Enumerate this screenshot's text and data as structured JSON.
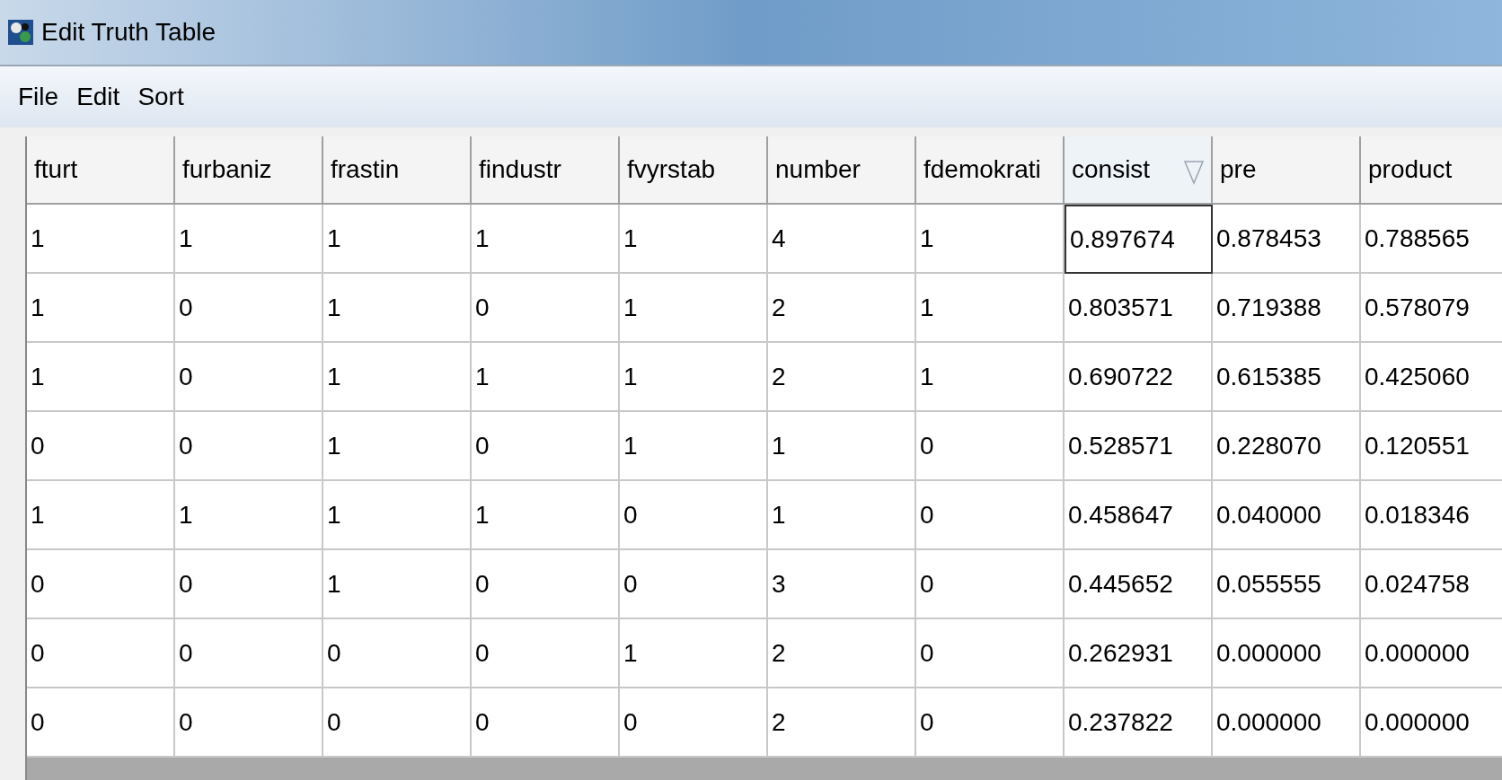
{
  "window": {
    "title": "Edit Truth Table"
  },
  "menu": [
    "File",
    "Edit",
    "Sort"
  ],
  "table": {
    "columns": [
      {
        "label": "fturt",
        "sorted": false
      },
      {
        "label": "furbaniz",
        "sorted": false
      },
      {
        "label": "frastin",
        "sorted": false
      },
      {
        "label": "findustr",
        "sorted": false
      },
      {
        "label": "fvyrstab",
        "sorted": false
      },
      {
        "label": "number",
        "sorted": false
      },
      {
        "label": "fdemokrati",
        "sorted": false
      },
      {
        "label": "consist",
        "sorted": true
      },
      {
        "label": "pre",
        "sorted": false
      },
      {
        "label": "product",
        "sorted": false
      }
    ],
    "rows": [
      {
        "cells": [
          {
            "text": "1",
            "focused": false
          },
          {
            "text": "1",
            "focused": false
          },
          {
            "text": "1",
            "focused": false
          },
          {
            "text": "1",
            "focused": false
          },
          {
            "text": "1",
            "focused": false
          },
          {
            "text": "4",
            "focused": false
          },
          {
            "text": "1",
            "focused": false
          },
          {
            "text": "0.897674",
            "focused": true
          },
          {
            "text": "0.878453",
            "focused": false
          },
          {
            "text": "0.788565",
            "focused": false
          }
        ]
      },
      {
        "cells": [
          {
            "text": "1",
            "focused": false
          },
          {
            "text": "0",
            "focused": false
          },
          {
            "text": "1",
            "focused": false
          },
          {
            "text": "0",
            "focused": false
          },
          {
            "text": "1",
            "focused": false
          },
          {
            "text": "2",
            "focused": false
          },
          {
            "text": "1",
            "focused": false
          },
          {
            "text": "0.803571",
            "focused": false
          },
          {
            "text": "0.719388",
            "focused": false
          },
          {
            "text": "0.578079",
            "focused": false
          }
        ]
      },
      {
        "cells": [
          {
            "text": "1",
            "focused": false
          },
          {
            "text": "0",
            "focused": false
          },
          {
            "text": "1",
            "focused": false
          },
          {
            "text": "1",
            "focused": false
          },
          {
            "text": "1",
            "focused": false
          },
          {
            "text": "2",
            "focused": false
          },
          {
            "text": "1",
            "focused": false
          },
          {
            "text": "0.690722",
            "focused": false
          },
          {
            "text": "0.615385",
            "focused": false
          },
          {
            "text": "0.425060",
            "focused": false
          }
        ]
      },
      {
        "cells": [
          {
            "text": "0",
            "focused": false
          },
          {
            "text": "0",
            "focused": false
          },
          {
            "text": "1",
            "focused": false
          },
          {
            "text": "0",
            "focused": false
          },
          {
            "text": "1",
            "focused": false
          },
          {
            "text": "1",
            "focused": false
          },
          {
            "text": "0",
            "focused": false
          },
          {
            "text": "0.528571",
            "focused": false
          },
          {
            "text": "0.228070",
            "focused": false
          },
          {
            "text": "0.120551",
            "focused": false
          }
        ]
      },
      {
        "cells": [
          {
            "text": "1",
            "focused": false
          },
          {
            "text": "1",
            "focused": false
          },
          {
            "text": "1",
            "focused": false
          },
          {
            "text": "1",
            "focused": false
          },
          {
            "text": "0",
            "focused": false
          },
          {
            "text": "1",
            "focused": false
          },
          {
            "text": "0",
            "focused": false
          },
          {
            "text": "0.458647",
            "focused": false
          },
          {
            "text": "0.040000",
            "focused": false
          },
          {
            "text": "0.018346",
            "focused": false
          }
        ]
      },
      {
        "cells": [
          {
            "text": "0",
            "focused": false
          },
          {
            "text": "0",
            "focused": false
          },
          {
            "text": "1",
            "focused": false
          },
          {
            "text": "0",
            "focused": false
          },
          {
            "text": "0",
            "focused": false
          },
          {
            "text": "3",
            "focused": false
          },
          {
            "text": "0",
            "focused": false
          },
          {
            "text": "0.445652",
            "focused": false
          },
          {
            "text": "0.055555",
            "focused": false
          },
          {
            "text": "0.024758",
            "focused": false
          }
        ]
      },
      {
        "cells": [
          {
            "text": "0",
            "focused": false
          },
          {
            "text": "0",
            "focused": false
          },
          {
            "text": "0",
            "focused": false
          },
          {
            "text": "0",
            "focused": false
          },
          {
            "text": "1",
            "focused": false
          },
          {
            "text": "2",
            "focused": false
          },
          {
            "text": "0",
            "focused": false
          },
          {
            "text": "0.262931",
            "focused": false
          },
          {
            "text": "0.000000",
            "focused": false
          },
          {
            "text": "0.000000",
            "focused": false
          }
        ]
      },
      {
        "cells": [
          {
            "text": "0",
            "focused": false
          },
          {
            "text": "0",
            "focused": false
          },
          {
            "text": "0",
            "focused": false
          },
          {
            "text": "0",
            "focused": false
          },
          {
            "text": "0",
            "focused": false
          },
          {
            "text": "2",
            "focused": false
          },
          {
            "text": "0",
            "focused": false
          },
          {
            "text": "0.237822",
            "focused": false
          },
          {
            "text": "0.000000",
            "focused": false
          },
          {
            "text": "0.000000",
            "focused": false
          }
        ]
      }
    ]
  }
}
